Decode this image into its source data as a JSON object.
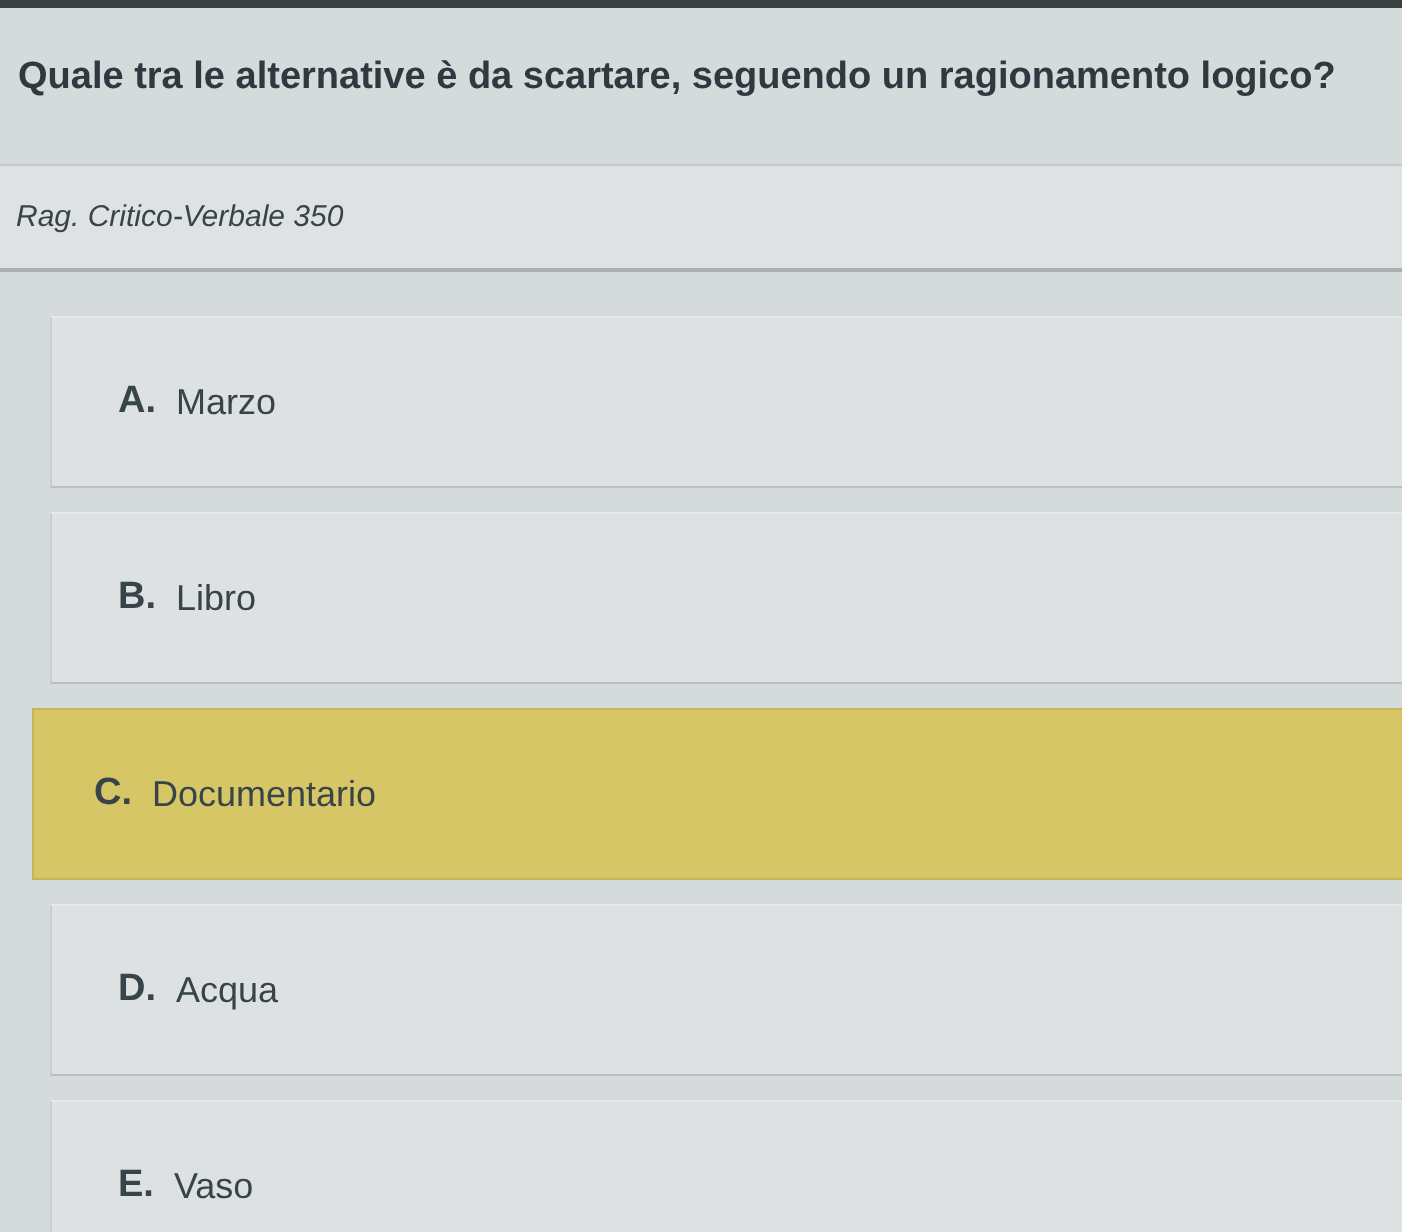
{
  "question": "Quale tra le alternative è da scartare, seguendo un ragionamento logico?",
  "category": "Rag. Critico-Verbale 350",
  "options": [
    {
      "letter": "A.",
      "text": "Marzo",
      "selected": false
    },
    {
      "letter": "B.",
      "text": "Libro",
      "selected": false
    },
    {
      "letter": "C.",
      "text": "Documentario",
      "selected": true
    },
    {
      "letter": "D.",
      "text": "Acqua",
      "selected": false
    },
    {
      "letter": "E.",
      "text": "Vaso",
      "selected": false
    }
  ]
}
